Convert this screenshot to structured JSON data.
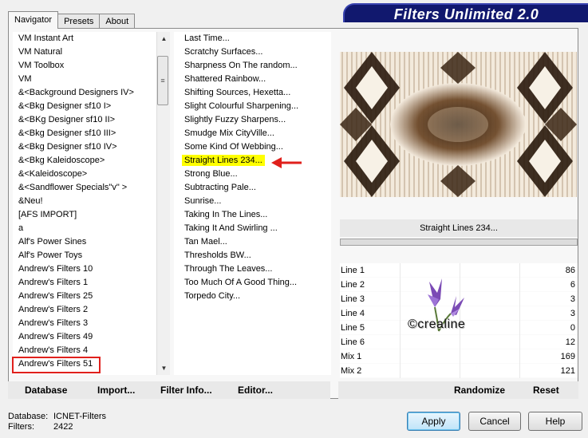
{
  "tabs": [
    "Navigator",
    "Presets",
    "About"
  ],
  "app_title": "Filters Unlimited 2.0",
  "categories": [
    "VM Instant Art",
    "VM Natural",
    "VM Toolbox",
    "VM",
    "&<Background Designers IV>",
    "&<Bkg Designer sf10 I>",
    "&<BKg Designer sf10 II>",
    "&<Bkg Designer sf10 III>",
    "&<Bkg Designer sf10 IV>",
    "&<Bkg Kaleidoscope>",
    "&<Kaleidoscope>",
    "&<Sandflower Specials\"v\" >",
    "&Neu!",
    "[AFS IMPORT]",
    "a",
    "Alf's Power Sines",
    "Alf's Power Toys",
    "Andrew's Filters 10",
    "Andrew's Filters 1",
    "Andrew's Filters 25",
    "Andrew's Filters 2",
    "Andrew's Filters 3",
    "Andrew's Filters 49",
    "Andrew's Filters 4",
    "Andrew's Filters 51"
  ],
  "filters": [
    "Last Time...",
    "Scratchy Surfaces...",
    "Sharpness On The random...",
    "Shattered Rainbow...",
    "Shifting Sources, Hexetta...",
    "Slight Colourful Sharpening...",
    "Slightly Fuzzy Sharpens...",
    "Smudge Mix CityVille...",
    "Some Kind Of Webbing...",
    "Straight Lines 234...",
    "Strong Blue...",
    "Subtracting Pale...",
    "Sunrise...",
    "Taking In The Lines...",
    "Taking It And Swirling ...",
    "Tan Mael...",
    "Thresholds BW...",
    "Through The Leaves...",
    "Too Much Of A Good Thing...",
    "Torpedo City..."
  ],
  "selected_filter": "Straight Lines 234...",
  "params": [
    {
      "name": "Line 1",
      "value": "86"
    },
    {
      "name": "Line 2",
      "value": "6"
    },
    {
      "name": "Line 3",
      "value": "3"
    },
    {
      "name": "Line 4",
      "value": "3"
    },
    {
      "name": "Line 5",
      "value": "0"
    },
    {
      "name": "Line 6",
      "value": "12"
    },
    {
      "name": "Mix 1",
      "value": "169"
    },
    {
      "name": "Mix 2",
      "value": "121"
    }
  ],
  "watermark": "©crealine",
  "bottom_buttons": {
    "database": "Database",
    "import": "Import...",
    "filter_info": "Filter Info...",
    "editor": "Editor...",
    "randomize": "Randomize",
    "reset": "Reset"
  },
  "info": {
    "database_label": "Database:",
    "database_value": "ICNET-Filters",
    "filters_label": "Filters:",
    "filters_value": "2422"
  },
  "dialog_buttons": {
    "apply": "Apply",
    "cancel": "Cancel",
    "help": "Help"
  },
  "colors": {
    "highlight": "#ffff00",
    "annotation_red": "#e0201c",
    "title_bg": "#11186e"
  }
}
